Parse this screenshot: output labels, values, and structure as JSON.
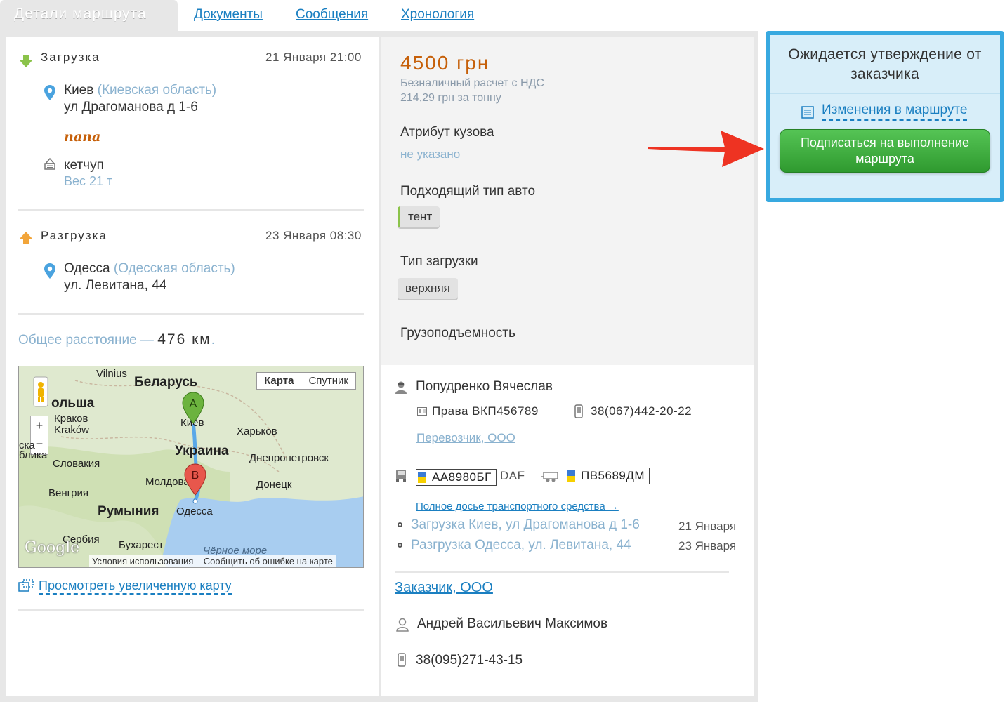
{
  "tabs": {
    "active": "Детали маршрута",
    "documents": "Документы",
    "messages": "Сообщения",
    "history": "Хронология"
  },
  "loading": {
    "title": "Загрузка",
    "date": "21 Января 21:00",
    "city": "Киев",
    "region": "(Киевская область)",
    "street": "ул Драгоманова д 1-6",
    "cargo_tag": "папа",
    "cargo": "кетчуп",
    "weight": "Вес 21 т"
  },
  "unloading": {
    "title": "Разгрузка",
    "date": "23 Января 08:30",
    "city": "Одесса",
    "region": "(Одесская область)",
    "street": "ул. Левитана, 44"
  },
  "distance": {
    "label": "Общее расстояние —",
    "value": "476 км",
    "suffix": "."
  },
  "map": {
    "btn_map": "Карта",
    "btn_satellite": "Спутник",
    "labels": {
      "vilnius": "Vilnius",
      "belarus": "Беларусь",
      "poland": "ольша",
      "krakow_ru": "Краков",
      "krakow": "Kraków",
      "kyiv": "Киев",
      "kharkiv": "Харьков",
      "ukraine": "Украина",
      "dnipro": "Днепропетровск",
      "slovakia": "Словакия",
      "donetsk": "Донецк",
      "moldova": "Молдова",
      "hungary": "Венгрия",
      "romania": "Румыния",
      "odesa": "Одесса",
      "serbia": "Сербия",
      "bucharest": "Бухарест",
      "black_sea": "Чёрное море",
      "republic": "блика",
      "czech": "ска"
    },
    "marker_a": "A",
    "marker_b": "B",
    "google": "Google",
    "terms": "Условия использования",
    "report": "Сообщить об ошибке на карте",
    "zoom_in": "+",
    "zoom_out": "−"
  },
  "map_link": "Просмотреть увеличенную карту",
  "price": {
    "amount": "4500 грн",
    "payment": "Безналичный расчет с НДС",
    "per_ton": "214,29 грн за тонну"
  },
  "attributes": {
    "body_title": "Атрибут кузова",
    "body_value": "не указано",
    "vehicle_title": "Подходящий тип авто",
    "vehicle_value": "тент",
    "loading_title": "Тип загрузки",
    "loading_value": "верхняя",
    "capacity_title": "Грузоподъемность"
  },
  "driver": {
    "name": "Попудренко Вячеслав",
    "license": "Права ВКП456789",
    "phone": "38(067)442-20-22",
    "carrier": "Перевозчик, ООО"
  },
  "vehicle": {
    "plate": "АА8980БГ",
    "brand": "DAF",
    "trailer_plate": "ПВ5689ДМ",
    "dossier_link": "Полное досье транспортного средства →"
  },
  "schedule": [
    {
      "text": "Загрузка Киев, ул Драгоманова д 1-6",
      "date": "21 Января"
    },
    {
      "text": "Разгрузка Одесса, ул. Левитана, 44",
      "date": "23 Января"
    }
  ],
  "customer": {
    "company": "Заказчик, ООО",
    "contact": "Андрей Васильевич Максимов",
    "phone": "38(095)271-43-15"
  },
  "status": {
    "title": "Ожидается утверждение от заказчика",
    "changes_link": "Изменения в маршруте",
    "sign_button": "Подписаться на выполнение маршрута"
  },
  "colors": {
    "accent": "#38a9e0",
    "price": "#c6600a",
    "button": "#3aa83a",
    "link": "#1a7fc1"
  }
}
